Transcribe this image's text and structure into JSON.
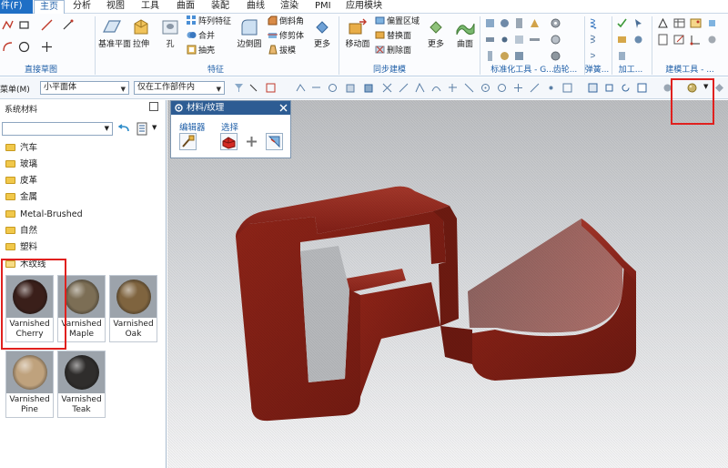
{
  "menubar": {
    "file": "件(F)",
    "tabs": [
      "主页",
      "分析",
      "视图",
      "工具",
      "曲面",
      "装配",
      "曲线",
      "渲染",
      "PMI",
      "应用模块"
    ],
    "active_index": 0
  },
  "ribbon": {
    "groups": [
      {
        "label": "直接草图"
      },
      {
        "label": "特征"
      },
      {
        "label": "同步建模"
      },
      {
        "label": "标准化工具 - G..."
      },
      {
        "label": "齿轮..."
      },
      {
        "label": "弹簧..."
      },
      {
        "label": "加工..."
      },
      {
        "label": "建模工具 - ..."
      }
    ],
    "feature_big": [
      {
        "label": "基准平面",
        "icon": "datum-plane-icon"
      },
      {
        "label": "拉伸",
        "icon": "extrude-icon"
      },
      {
        "label": "孔",
        "icon": "hole-icon"
      }
    ],
    "feature_small": [
      {
        "label": "阵列特征",
        "icon": "pattern-feature-icon"
      },
      {
        "label": "合并",
        "icon": "unite-icon"
      },
      {
        "label": "抽壳",
        "icon": "shell-icon"
      }
    ],
    "edge_big": {
      "label": "边倒圆",
      "icon": "edge-blend-icon"
    },
    "edge_small": [
      {
        "label": "倒斜角",
        "icon": "chamfer-icon"
      },
      {
        "label": "修剪体",
        "icon": "trim-body-icon"
      },
      {
        "label": "拔模",
        "icon": "draft-icon"
      }
    ],
    "more1": "更多",
    "sync_big": {
      "label": "移动面",
      "icon": "move-face-icon"
    },
    "sync_small": [
      {
        "label": "偏置区域",
        "icon": "offset-region-icon"
      },
      {
        "label": "替换面",
        "icon": "replace-face-icon"
      },
      {
        "label": "删除面",
        "icon": "delete-face-icon"
      }
    ],
    "more2": "更多",
    "surface": "曲面"
  },
  "selectionbar": {
    "menu_fragment": "菜单(M)",
    "filter": "小平面体",
    "scope": "仅在工作部件内"
  },
  "materials_panel": {
    "title": "系统材料",
    "folders": [
      "汽车",
      "玻璃",
      "皮革",
      "金属",
      "Metal-Brushed",
      "自然",
      "塑料",
      "木纹线"
    ],
    "swatches": [
      {
        "line1": "Varnished",
        "line2": "Cherry",
        "color": "#3a1f1a"
      },
      {
        "line1": "Varnished",
        "line2": "Maple",
        "color": "#7c6e55"
      },
      {
        "line1": "Varnished",
        "line2": "Oak",
        "color": "#7f643f"
      },
      {
        "line1": "Varnished",
        "line2": "Pine",
        "color": "#bfa27d"
      },
      {
        "line1": "Varnished",
        "line2": "Teak",
        "color": "#2f2d2c"
      }
    ]
  },
  "material_dialog": {
    "title": "材料/纹理",
    "editor_label": "编辑器",
    "select_label": "选择"
  },
  "colors": {
    "ribbon_blue": "#1f5fa8",
    "file_tab": "#1f6fc5",
    "dialog_header": "#2d5c93",
    "highlight_red": "#e0201e",
    "model_red": "#7e1d15"
  }
}
